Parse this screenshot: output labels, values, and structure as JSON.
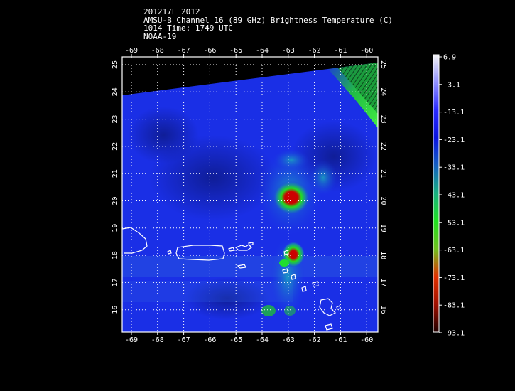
{
  "header": {
    "line1": "201217L 2012",
    "line2": "AMSU-B Channel 16 (89 GHz) Brightness Temperature (C)",
    "line3": "1014 Time: 1749 UTC",
    "line4": "NOAA-19"
  },
  "map": {
    "lon_labels": [
      "-69",
      "-68",
      "-67",
      "-66",
      "-65",
      "-64",
      "-63",
      "-62",
      "-61",
      "-60"
    ],
    "lat_labels": [
      "25",
      "24",
      "23",
      "22",
      "21",
      "20",
      "19",
      "18",
      "17",
      "16"
    ],
    "colors": {
      "background": "#000000",
      "field_base": "#1a2fe6",
      "coast": "#ffffff",
      "grid": "#ffffff"
    }
  },
  "colorbar": {
    "labels": [
      "6.9",
      "-3.1",
      "-13.1",
      "-23.1",
      "-33.1",
      "-43.1",
      "-53.1",
      "-63.1",
      "-73.1",
      "-83.1",
      "-93.1"
    ],
    "stops": [
      "#f5f5f5",
      "#9090ff",
      "#2a2aff",
      "#0a14e0",
      "#1460c0",
      "#18b080",
      "#20e020",
      "#70c020",
      "#e03000",
      "#a01000",
      "#200000"
    ]
  }
}
